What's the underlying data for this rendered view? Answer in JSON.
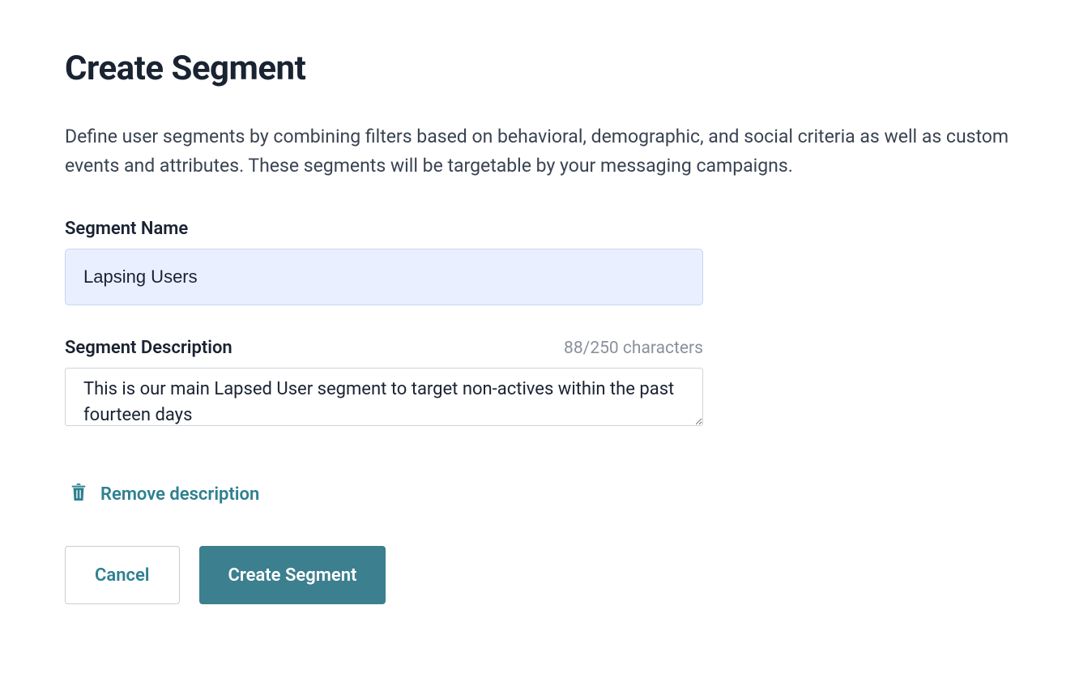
{
  "page": {
    "title": "Create Segment",
    "description": "Define user segments by combining filters based on behavioral, demographic, and social criteria as well as custom events and attributes. These segments will be targetable by your messaging campaigns."
  },
  "segmentName": {
    "label": "Segment Name",
    "value": "Lapsing Users"
  },
  "segmentDescription": {
    "label": "Segment Description",
    "counter": "88/250 characters",
    "value": "This is our main Lapsed User segment to target non-actives within the past fourteen days"
  },
  "actions": {
    "removeDescription": "Remove description",
    "cancel": "Cancel",
    "createSegment": "Create Segment"
  }
}
